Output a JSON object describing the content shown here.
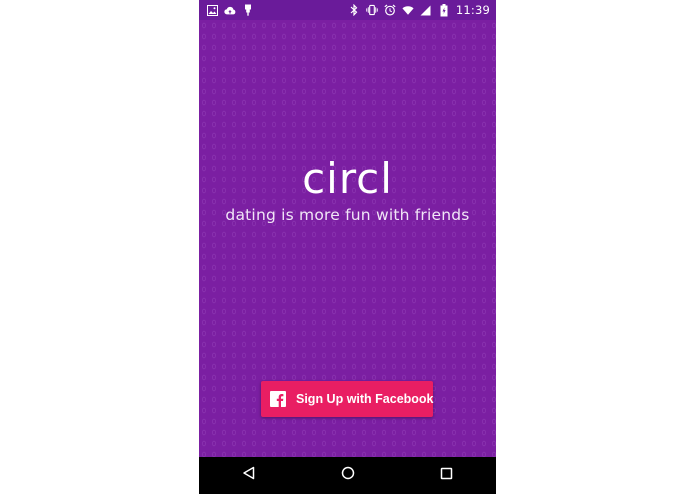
{
  "status_bar": {
    "time": "11:39",
    "left_icons": [
      "image-icon",
      "cloud-upload-icon",
      "usb-icon"
    ],
    "right_icons": [
      "bluetooth-icon",
      "vibrate-icon",
      "alarm-icon",
      "wifi-icon",
      "signal-icon",
      "battery-icon"
    ]
  },
  "app": {
    "name": "circl",
    "tagline": "dating is more fun with friends",
    "signup_button": {
      "label": "Sign Up with Facebook",
      "icon": "facebook-icon"
    }
  },
  "nav_bar": {
    "buttons": [
      "back-icon",
      "home-icon",
      "recents-icon"
    ]
  },
  "colors": {
    "background": "#7b1fa2",
    "status_bar": "#6a1b9a",
    "button": "#e91e63",
    "nav_bar": "#000000",
    "text": "#ffffff"
  }
}
